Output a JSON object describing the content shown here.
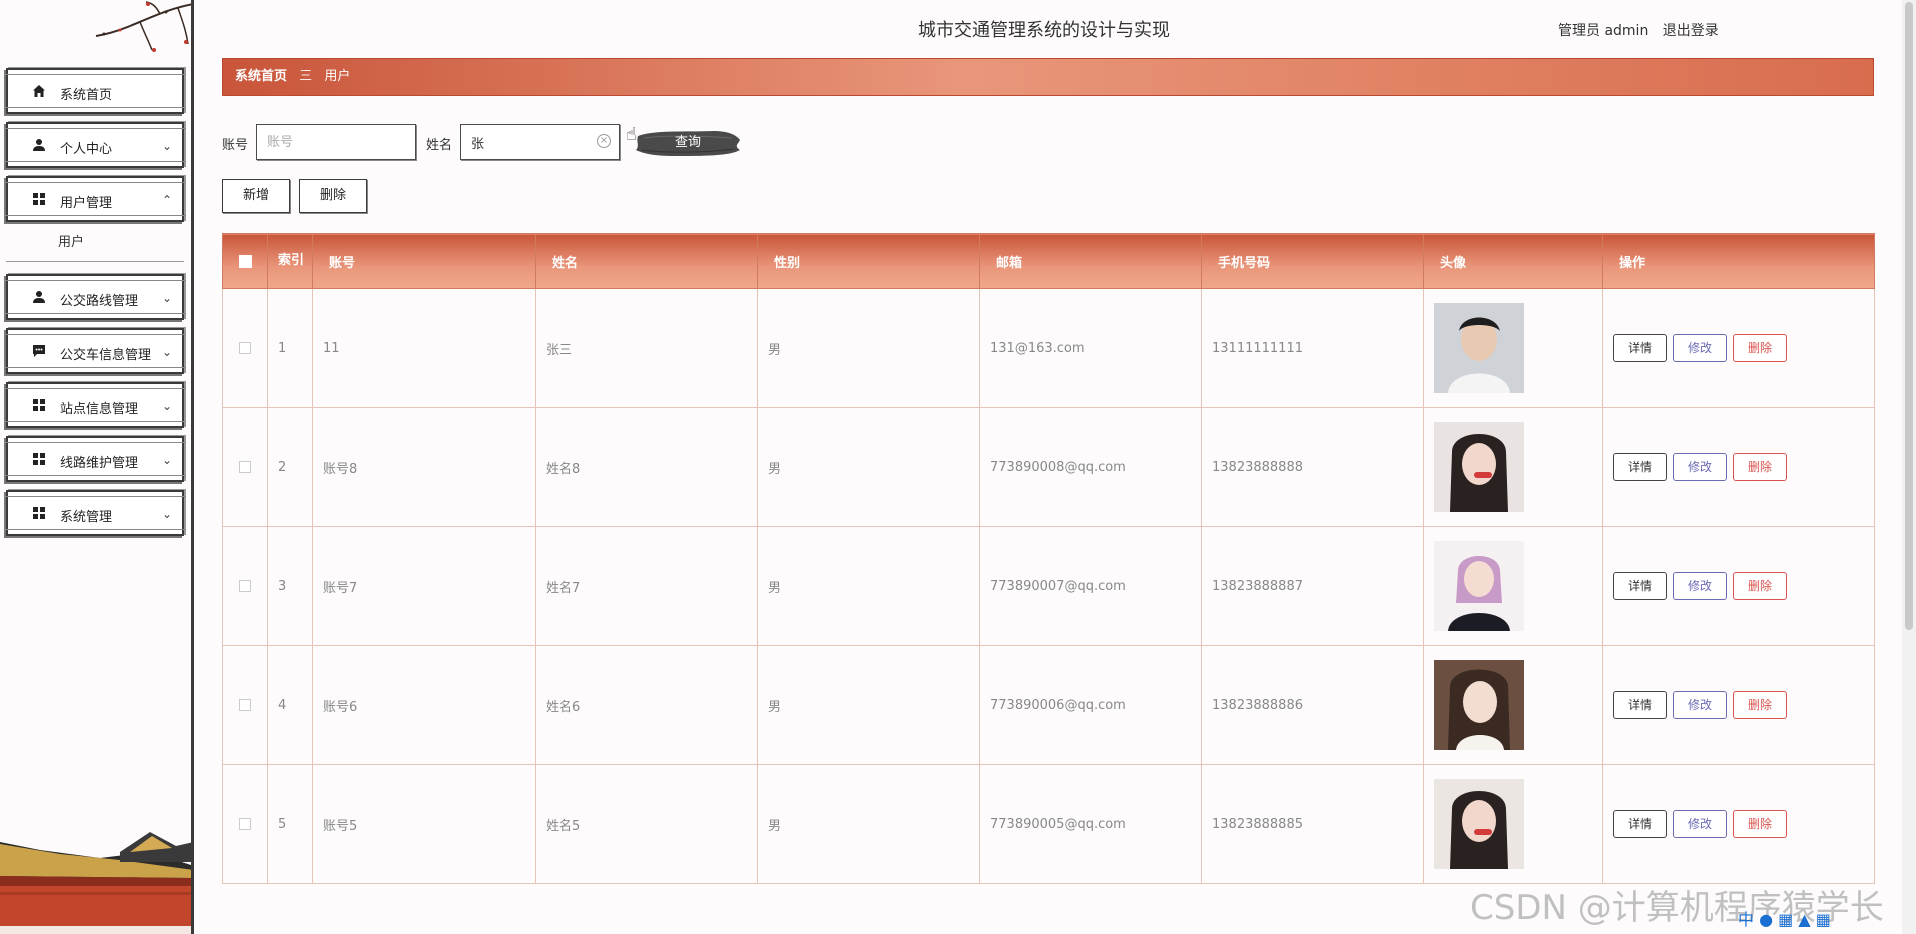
{
  "header": {
    "title": "城市交通管理系统的设计与实现",
    "role": "管理员 admin",
    "logout": "退出登录"
  },
  "sidebar": {
    "items": [
      {
        "label": "系统首页",
        "icon": "home-icon"
      },
      {
        "label": "个人中心",
        "icon": "person-icon"
      },
      {
        "label": "用户管理",
        "icon": "grid-icon"
      },
      {
        "label": "公交路线管理",
        "icon": "person-icon"
      },
      {
        "label": "公交车信息管理",
        "icon": "chat-icon"
      },
      {
        "label": "站点信息管理",
        "icon": "grid-icon"
      },
      {
        "label": "线路维护管理",
        "icon": "grid-icon"
      },
      {
        "label": "系统管理",
        "icon": "grid-icon"
      }
    ],
    "submenu": {
      "label": "用户"
    }
  },
  "breadcrumb": {
    "home": "系统首页",
    "separator": "三",
    "current": "用户"
  },
  "search": {
    "account_label": "账号",
    "account_placeholder": "账号",
    "account_value": "",
    "name_label": "姓名",
    "name_value": "张",
    "query_button": "查询"
  },
  "actions": {
    "add": "新增",
    "delete": "删除"
  },
  "table": {
    "columns": [
      "索引",
      "账号",
      "姓名",
      "性别",
      "邮箱",
      "手机号码",
      "头像",
      "操作"
    ],
    "rows": [
      {
        "index": "1",
        "account": "11",
        "name": "张三",
        "gender": "男",
        "email": "131@163.com",
        "phone": "13111111111"
      },
      {
        "index": "2",
        "account": "账号8",
        "name": "姓名8",
        "gender": "男",
        "email": "773890008@qq.com",
        "phone": "13823888888"
      },
      {
        "index": "3",
        "account": "账号7",
        "name": "姓名7",
        "gender": "男",
        "email": "773890007@qq.com",
        "phone": "13823888887"
      },
      {
        "index": "4",
        "account": "账号6",
        "name": "姓名6",
        "gender": "男",
        "email": "773890006@qq.com",
        "phone": "13823888886"
      },
      {
        "index": "5",
        "account": "账号5",
        "name": "姓名5",
        "gender": "男",
        "email": "773890005@qq.com",
        "phone": "13823888885"
      }
    ],
    "row_actions": {
      "detail": "详情",
      "edit": "修改",
      "delete": "删除"
    }
  },
  "watermark": "CSDN @计算机程序猿学长",
  "ime": "中"
}
